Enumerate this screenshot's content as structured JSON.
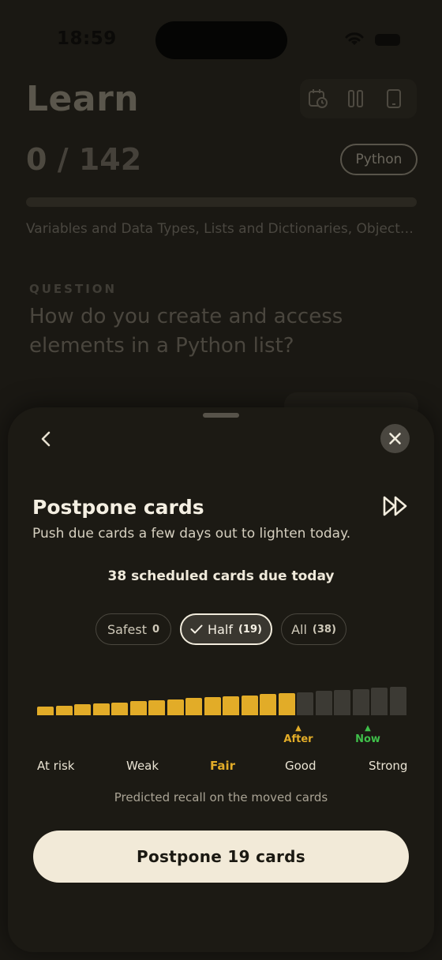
{
  "status": {
    "time": "18:59"
  },
  "page": {
    "title": "Learn",
    "counter": {
      "current": "0",
      "separator": "/",
      "total": "142"
    },
    "language": "Python",
    "topics": "Variables and Data Types, Lists and Dictionaries, Object…",
    "question_label": "QUESTION",
    "question": "How do you create and access elements in a Python list?"
  },
  "sheet": {
    "title": "Postpone cards",
    "subtitle": "Push due cards a few days out to lighten today.",
    "due_summary": "38 scheduled cards due today",
    "options": [
      {
        "label": "Safest",
        "count": "0",
        "selected": false
      },
      {
        "label": "Half",
        "count": "(19)",
        "selected": true
      },
      {
        "label": "All",
        "count": "(38)",
        "selected": false
      }
    ],
    "recall_bar": {
      "total_segments": 20,
      "filled_segments": 14
    },
    "markers": {
      "after": "After",
      "now": "Now"
    },
    "scale_labels": [
      "At risk",
      "Weak",
      "Fair",
      "Good",
      "Strong"
    ],
    "caption": "Predicted recall on the moved cards",
    "cta_label": "Postpone 19 cards"
  },
  "colors": {
    "accent_gold": "#e2ac28",
    "bar_inactive": "#3c3a34",
    "now_green": "#3fbf4a",
    "cta_bg": "#f2ead8"
  },
  "icons": [
    "calendar-clock-icon",
    "columns-icon",
    "phone-icon",
    "back-chevron-icon",
    "close-icon",
    "fast-forward-icon",
    "check-icon",
    "wifi-icon",
    "battery-icon"
  ]
}
